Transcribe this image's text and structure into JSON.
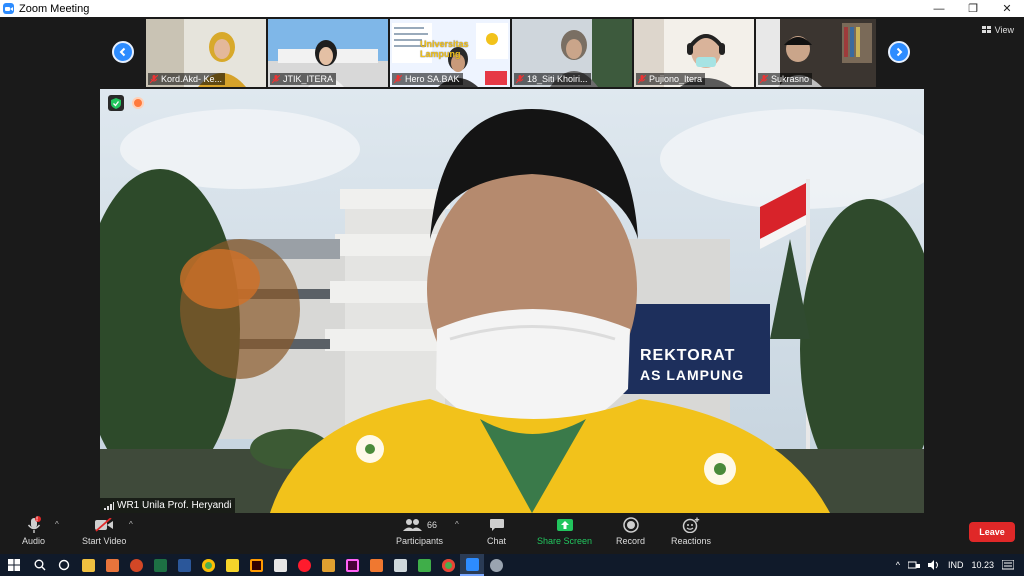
{
  "window": {
    "title": "Zoom Meeting",
    "controls": [
      "—",
      "❐",
      "✕"
    ]
  },
  "gallery": {
    "tiles": [
      {
        "name": "Kord.Akd- Ke..."
      },
      {
        "name": "JTIK_ITERA"
      },
      {
        "name": "Hero SA.BAK"
      },
      {
        "name": "18_Siti Khoiri..."
      },
      {
        "name": "Pujiono_Itera"
      },
      {
        "name": "Sukrasno"
      }
    ],
    "tile3_slide_title": "Universitas Lampung"
  },
  "view_button": {
    "label": "View"
  },
  "main_video": {
    "speaker_label": "WR1 Unila Prof. Heryandi",
    "building_sign": "REKTORAT",
    "building_sign2": "AS LAMPUNG"
  },
  "toolbar": {
    "audio": {
      "label": "Audio",
      "badge": "!"
    },
    "start_video": {
      "label": "Start Video"
    },
    "participants": {
      "label": "Participants",
      "count": "66"
    },
    "chat": {
      "label": "Chat"
    },
    "share_screen": {
      "label": "Share Screen"
    },
    "record": {
      "label": "Record"
    },
    "reactions": {
      "label": "Reactions"
    },
    "leave": {
      "label": "Leave"
    }
  },
  "taskbar": {
    "language": "IND",
    "time": "10.23"
  },
  "colors": {
    "zoom_blue": "#2d8cff",
    "share_green": "#22c55e",
    "leave_red": "#e02828",
    "shirt_yellow": "#f2c21b"
  }
}
